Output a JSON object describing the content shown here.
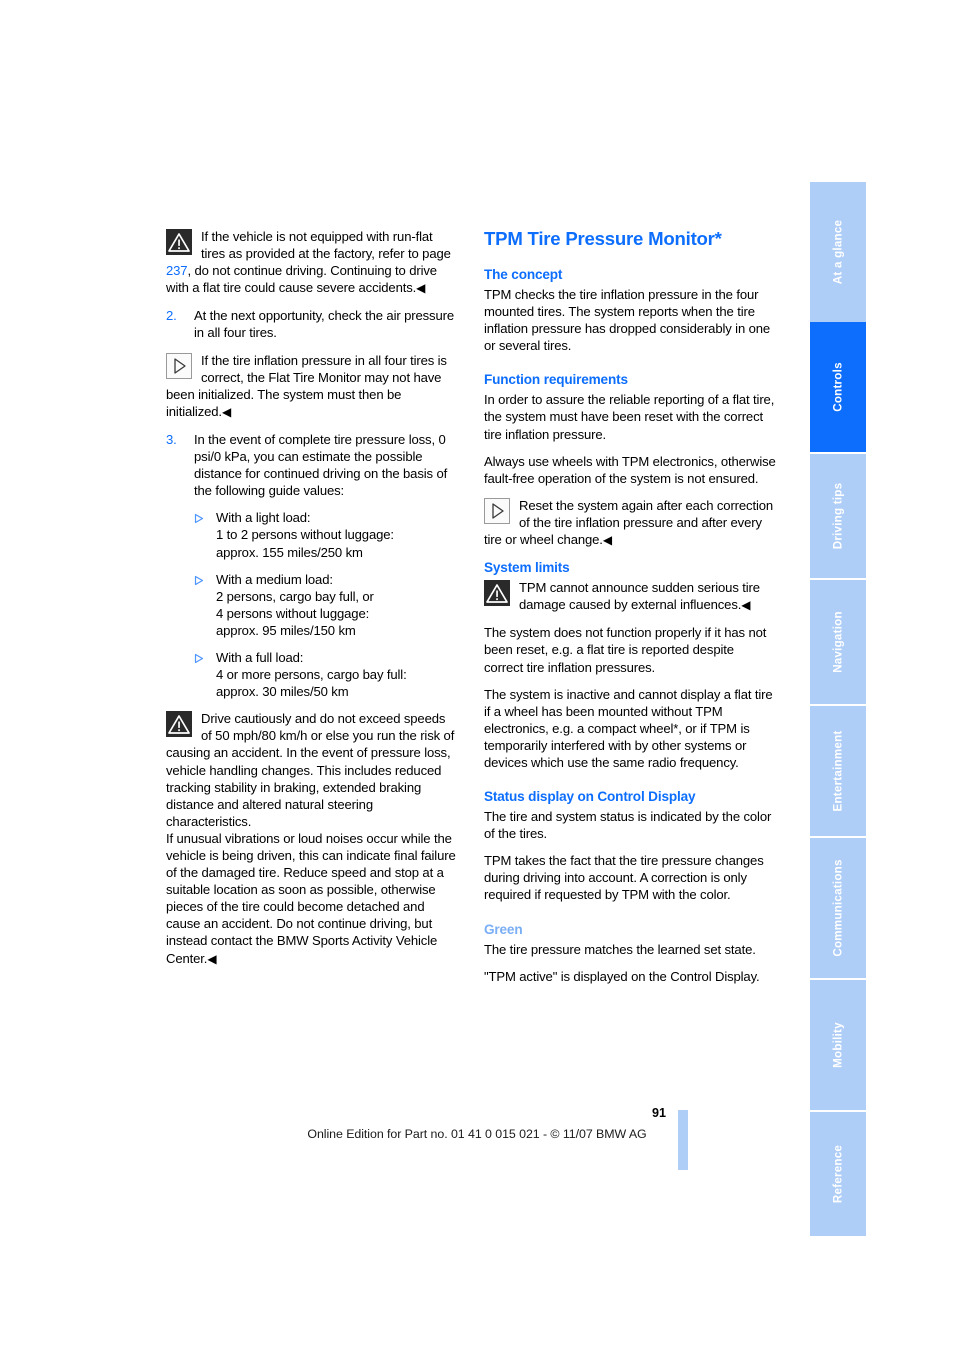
{
  "page": {
    "number": "91",
    "footer": "Online Edition for Part no. 01 41 0 015 021 - © 11/07 BMW AG"
  },
  "sidebar": {
    "tabs": [
      {
        "label": "At a glance",
        "active": false
      },
      {
        "label": "Controls",
        "active": true
      },
      {
        "label": "Driving tips",
        "active": false
      },
      {
        "label": "Navigation",
        "active": false
      },
      {
        "label": "Entertainment",
        "active": false
      },
      {
        "label": "Communications",
        "active": false
      },
      {
        "label": "Mobility",
        "active": false
      },
      {
        "label": "Reference",
        "active": false
      }
    ],
    "colors": {
      "inactive": "#aecdf7",
      "active": "#0d6efd",
      "label": "#ffffff"
    }
  },
  "left_column": {
    "warning_1": {
      "text_before_ref": "If the vehicle is not equipped with run-flat tires as provided at the factory, refer to page ",
      "ref": "237",
      "text_after_ref": ", do not continue driving. Continuing to drive with a flat tire could cause severe accidents.",
      "endmark": "◀"
    },
    "step_2": {
      "number": "2.",
      "text": "At the next opportunity, check the air pressure in all four tires."
    },
    "note_1": {
      "text": "If the tire inflation pressure in all four tires is correct, the Flat Tire Monitor may not have been initialized. The system must then be initialized.",
      "endmark": "◀"
    },
    "step_3": {
      "number": "3.",
      "text": "In the event of complete tire pressure loss, 0 psi/0 kPa, you can estimate the possible distance for continued driving on the basis of the following guide values:"
    },
    "bullets": [
      {
        "lines": [
          "With a light load:",
          "1 to 2 persons without luggage:",
          "approx. 155 miles/250 km"
        ]
      },
      {
        "lines": [
          "With a medium load:",
          "2 persons, cargo bay full, or",
          "4 persons without luggage:",
          "approx. 95 miles/150 km"
        ]
      },
      {
        "lines": [
          "With a full load:",
          "4 or more persons, cargo bay full:",
          "approx. 30 miles/50 km"
        ]
      }
    ],
    "warning_2": {
      "text": "Drive cautiously and do not exceed speeds of 50 mph/80 km/h or else you run the risk of causing an accident. In the event of pressure loss, vehicle handling changes. This includes reduced tracking stability in braking, extended braking distance and altered natural steering characteristics."
    },
    "warning_2_cont": {
      "text": "If unusual vibrations or loud noises occur while the vehicle is being driven, this can indicate final failure of the damaged tire. Reduce speed and stop at a suitable location as soon as possible, otherwise pieces of the tire could become detached and cause an accident. Do not continue driving, but instead contact the BMW Sports Activity Vehicle Center.",
      "endmark": "◀"
    }
  },
  "right_column": {
    "title": "TPM Tire Pressure Monitor*",
    "sections": [
      {
        "heading": "The concept",
        "paragraphs": [
          "TPM checks the tire inflation pressure in the four mounted tires. The system reports when the tire inflation pressure has dropped considerably in one or several tires."
        ]
      },
      {
        "heading": "Function requirements",
        "paragraphs": [
          "In order to assure the reliable reporting of a flat tire, the system must have been reset with the correct tire inflation pressure.",
          "Always use wheels with TPM electronics, otherwise fault-free operation of the system is not ensured."
        ],
        "note": {
          "text": "Reset the system again after each correction of the tire inflation pressure and after every tire or wheel change.",
          "endmark": "◀"
        }
      },
      {
        "heading": "System limits",
        "warning": {
          "text": "TPM cannot announce sudden serious tire damage caused by external influences.",
          "endmark": "◀"
        },
        "paragraphs": [
          "The system does not function properly if it has not been reset, e.g. a flat tire is reported despite correct tire inflation pressures.",
          "The system is inactive and cannot display a flat tire if a wheel has been mounted without TPM electronics, e.g. a compact wheel*, or if TPM is temporarily interfered with by other systems or devices which use the same radio frequency."
        ]
      },
      {
        "heading": "Status display on Control Display",
        "paragraphs": [
          "The tire and system status is indicated by the color of the tires.",
          "TPM takes the fact that the tire pressure changes during driving into account. A correction is only required if requested by TPM with the color."
        ]
      },
      {
        "heading": "Green",
        "heading_style": "light",
        "paragraphs": [
          "The tire pressure matches the learned set state.",
          "\"TPM active\" is displayed on the Control Display."
        ]
      }
    ]
  },
  "colors": {
    "accent_blue": "#0d6efd",
    "light_blue": "#aecdf7",
    "green_heading": "#7aaef5"
  }
}
